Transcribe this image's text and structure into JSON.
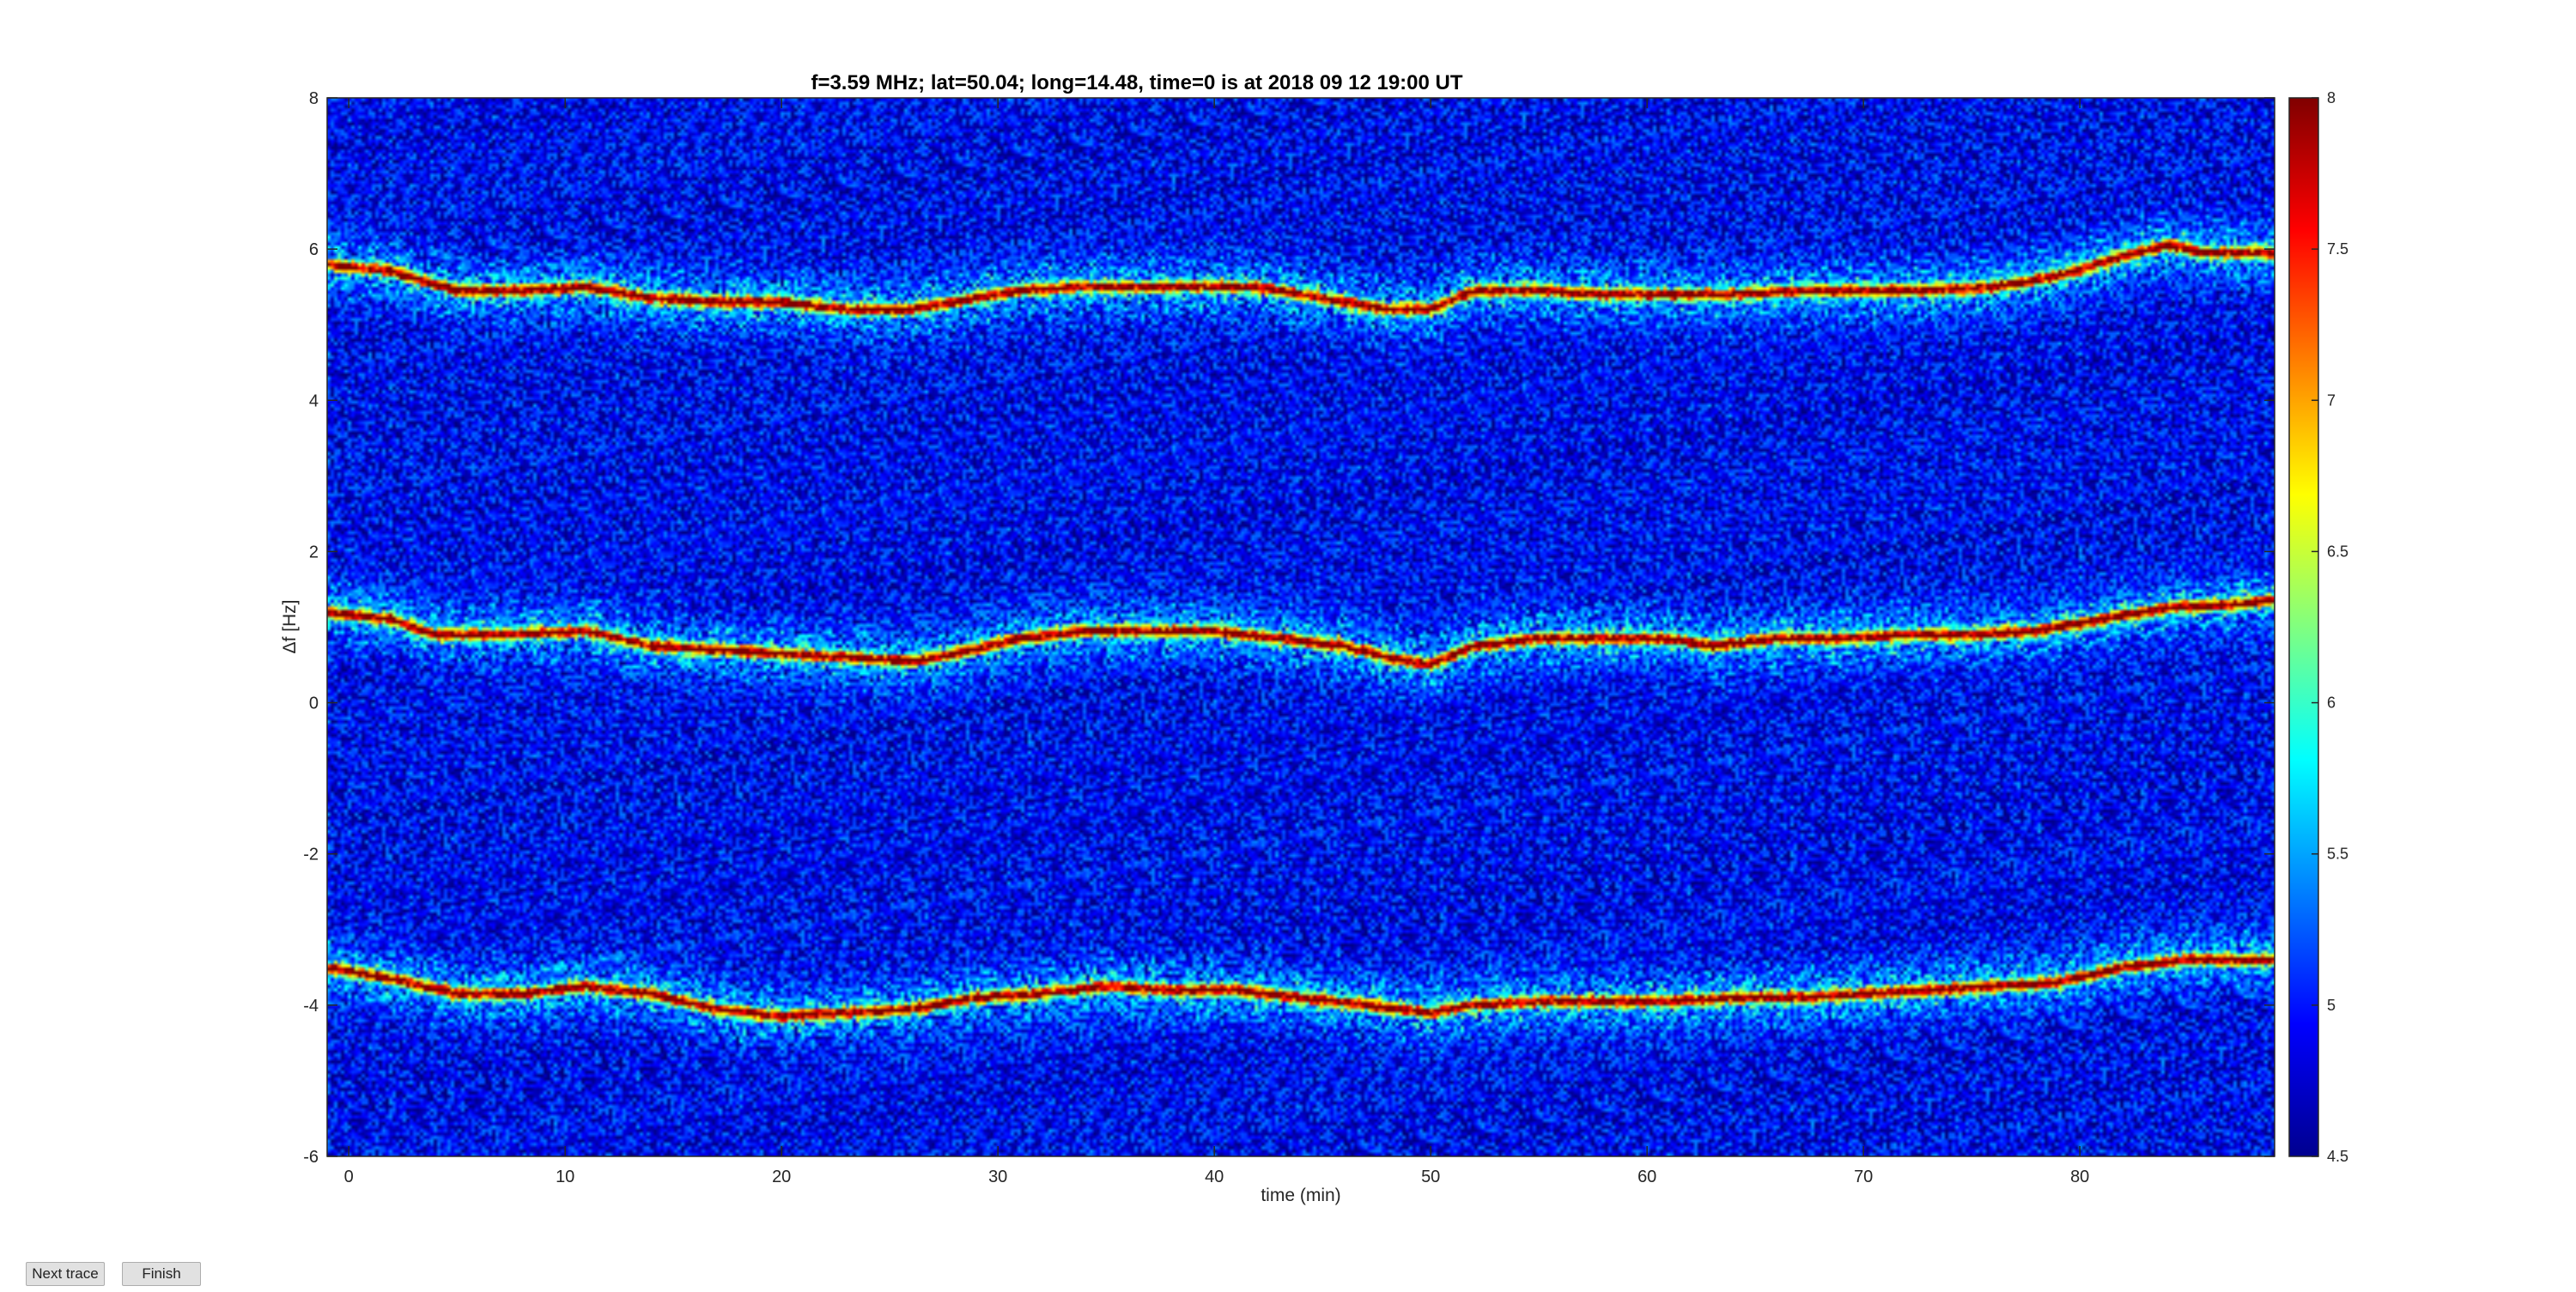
{
  "chart_data": {
    "type": "heatmap",
    "title": "f=3.59 MHz;  lat=50.04; long=14.48, time=0 is at 2018 09 12 19:00 UT",
    "xlabel": "time (min)",
    "ylabel": "Δf [Hz]",
    "xlim": [
      -1,
      89
    ],
    "ylim": [
      -6,
      8
    ],
    "xticks": [
      0,
      10,
      20,
      30,
      40,
      50,
      60,
      70,
      80
    ],
    "xtick_labels": [
      "0",
      "10",
      "20",
      "30",
      "40",
      "50",
      "60",
      "70",
      "80"
    ],
    "yticks": [
      -6,
      -4,
      -2,
      0,
      2,
      4,
      6,
      8
    ],
    "ytick_labels": [
      "-6",
      "-4",
      "-2",
      "0",
      "2",
      "4",
      "6",
      "8"
    ],
    "colorbar": {
      "clim": [
        4.5,
        8
      ],
      "ticks": [
        4.5,
        5,
        5.5,
        6,
        6.5,
        7,
        7.5,
        8
      ],
      "tick_labels": [
        "4.5",
        "5",
        "5.5",
        "6",
        "6.5",
        "7",
        "7.5",
        "8"
      ],
      "colormap": "jet"
    },
    "background_level": 4.9,
    "traces": [
      {
        "peak_level": 8,
        "points": [
          [
            -1,
            5.8
          ],
          [
            2,
            5.7
          ],
          [
            5,
            5.45
          ],
          [
            8,
            5.45
          ],
          [
            11,
            5.5
          ],
          [
            14,
            5.35
          ],
          [
            17,
            5.3
          ],
          [
            20,
            5.3
          ],
          [
            23,
            5.2
          ],
          [
            26,
            5.2
          ],
          [
            29,
            5.35
          ],
          [
            31,
            5.45
          ],
          [
            34,
            5.5
          ],
          [
            37,
            5.5
          ],
          [
            40,
            5.5
          ],
          [
            42,
            5.5
          ],
          [
            45,
            5.35
          ],
          [
            48,
            5.2
          ],
          [
            50,
            5.2
          ],
          [
            52,
            5.45
          ],
          [
            55,
            5.45
          ],
          [
            58,
            5.4
          ],
          [
            61,
            5.4
          ],
          [
            64,
            5.4
          ],
          [
            67,
            5.45
          ],
          [
            70,
            5.45
          ],
          [
            73,
            5.45
          ],
          [
            76,
            5.5
          ],
          [
            79,
            5.65
          ],
          [
            82,
            5.9
          ],
          [
            84,
            6.05
          ],
          [
            86,
            5.95
          ],
          [
            89,
            5.95
          ]
        ]
      },
      {
        "peak_level": 8,
        "points": [
          [
            -1,
            1.2
          ],
          [
            2,
            1.1
          ],
          [
            4,
            0.9
          ],
          [
            7,
            0.9
          ],
          [
            11,
            0.95
          ],
          [
            14,
            0.75
          ],
          [
            17,
            0.7
          ],
          [
            20,
            0.65
          ],
          [
            23,
            0.6
          ],
          [
            26,
            0.55
          ],
          [
            28,
            0.65
          ],
          [
            31,
            0.85
          ],
          [
            34,
            0.95
          ],
          [
            37,
            0.95
          ],
          [
            40,
            0.95
          ],
          [
            43,
            0.85
          ],
          [
            46,
            0.75
          ],
          [
            48,
            0.6
          ],
          [
            50,
            0.5
          ],
          [
            52,
            0.75
          ],
          [
            55,
            0.85
          ],
          [
            58,
            0.85
          ],
          [
            61,
            0.85
          ],
          [
            63,
            0.75
          ],
          [
            66,
            0.85
          ],
          [
            69,
            0.85
          ],
          [
            72,
            0.9
          ],
          [
            75,
            0.9
          ],
          [
            78,
            0.95
          ],
          [
            81,
            1.1
          ],
          [
            84,
            1.25
          ],
          [
            87,
            1.3
          ],
          [
            89,
            1.35
          ]
        ]
      },
      {
        "peak_level": 8,
        "points": [
          [
            -1,
            -3.5
          ],
          [
            2,
            -3.65
          ],
          [
            5,
            -3.85
          ],
          [
            8,
            -3.85
          ],
          [
            11,
            -3.75
          ],
          [
            14,
            -3.85
          ],
          [
            17,
            -4.05
          ],
          [
            20,
            -4.15
          ],
          [
            23,
            -4.1
          ],
          [
            26,
            -4.05
          ],
          [
            29,
            -3.9
          ],
          [
            32,
            -3.85
          ],
          [
            35,
            -3.75
          ],
          [
            38,
            -3.8
          ],
          [
            41,
            -3.8
          ],
          [
            44,
            -3.9
          ],
          [
            47,
            -4.0
          ],
          [
            50,
            -4.1
          ],
          [
            52,
            -4.0
          ],
          [
            55,
            -3.95
          ],
          [
            58,
            -3.95
          ],
          [
            61,
            -3.95
          ],
          [
            64,
            -3.9
          ],
          [
            67,
            -3.9
          ],
          [
            70,
            -3.85
          ],
          [
            73,
            -3.8
          ],
          [
            76,
            -3.75
          ],
          [
            79,
            -3.7
          ],
          [
            82,
            -3.5
          ],
          [
            85,
            -3.4
          ],
          [
            89,
            -3.4
          ]
        ]
      }
    ]
  },
  "buttons": {
    "next_trace": "Next trace",
    "finish": "Finish"
  }
}
